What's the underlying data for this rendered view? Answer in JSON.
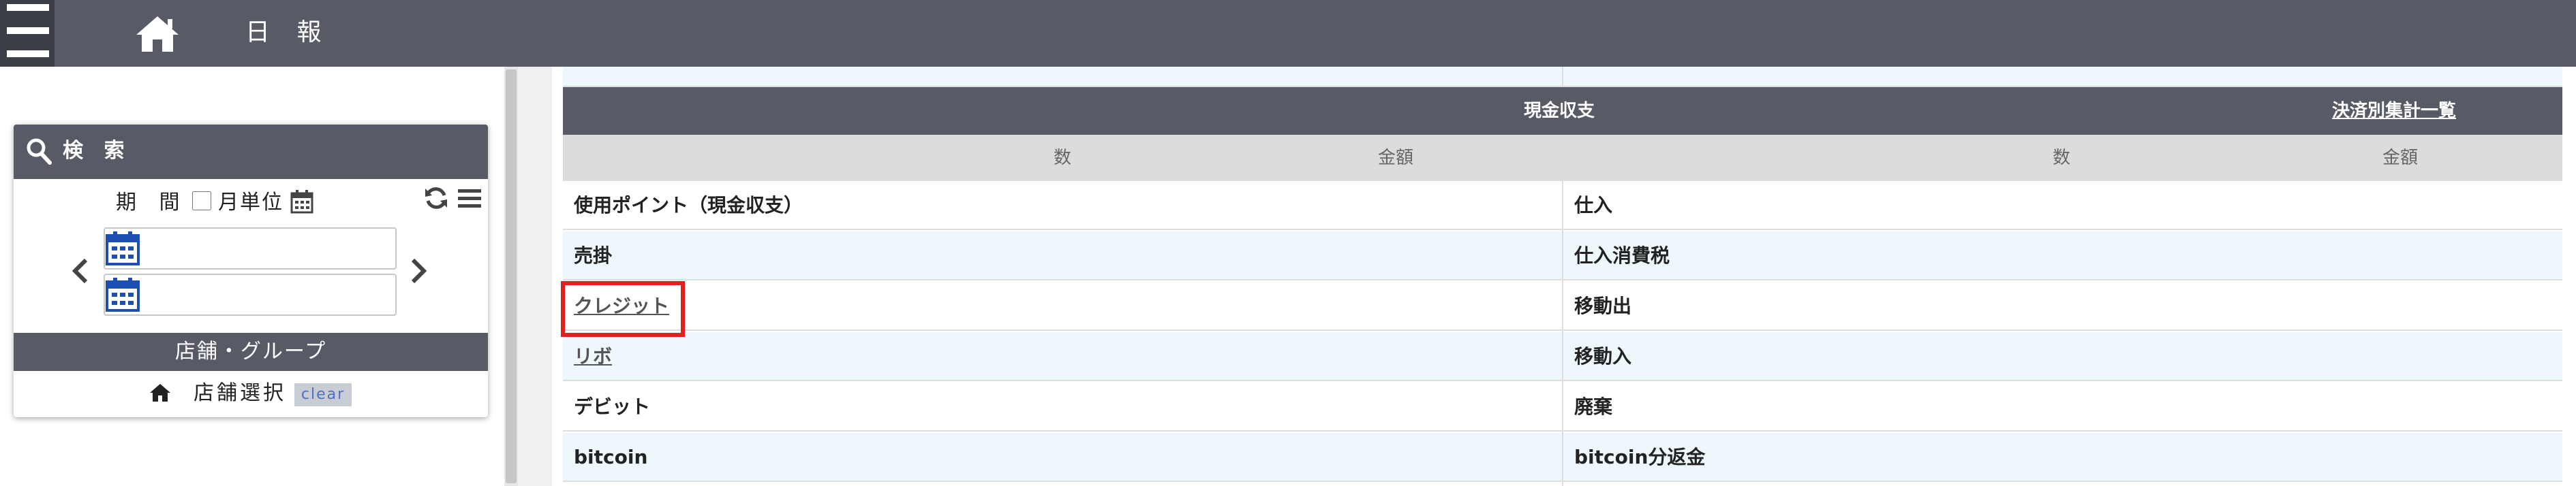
{
  "header": {
    "title": "日 報",
    "menu_icon": "hamburger-icon",
    "home_icon": "home-icon"
  },
  "search": {
    "title": "検 索",
    "period_label": "期 間",
    "month_unit_label": "月単位",
    "month_unit_checked": false,
    "date_from": "",
    "date_to": "",
    "store_group_header": "店舗・グループ",
    "store_select_label": "店舗選択",
    "clear_label": "clear"
  },
  "table": {
    "header_title": "現金収支",
    "header_link": "決済別集計一覧",
    "columns": [
      "数",
      "金額",
      "数",
      "金額"
    ],
    "left_rows": [
      "使用ポイント（現金収支）",
      "売掛",
      "クレジット",
      "リボ",
      "デビット",
      "bitcoin"
    ],
    "right_rows": [
      "仕入",
      "仕入消費税",
      "移動出",
      "移動入",
      "廃棄",
      "bitcoin分返金"
    ]
  },
  "colors": {
    "header_bg": "#585a66",
    "menu_bg": "#3c3e48",
    "row_alt": "#eef8fc",
    "subheader_bg": "#dcdcdc",
    "highlight": "#e31f1f"
  }
}
